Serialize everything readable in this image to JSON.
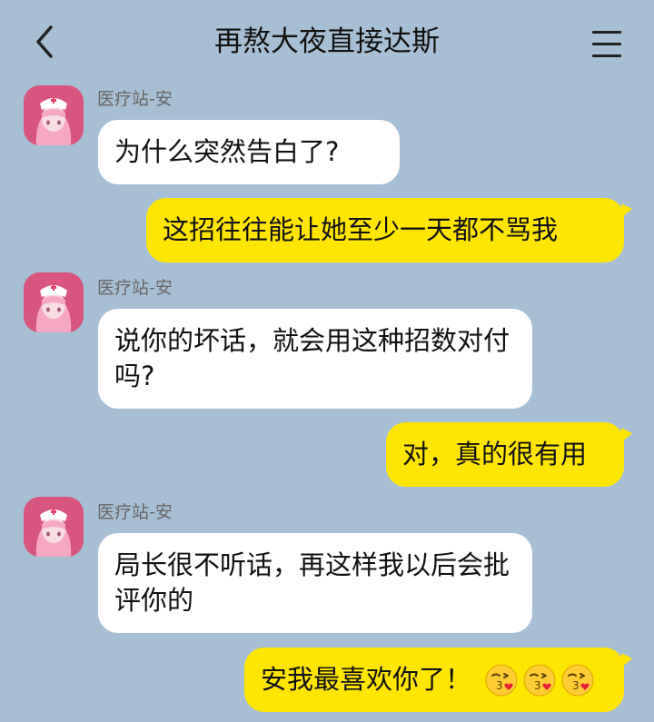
{
  "header": {
    "title": "再熬大夜直接达斯",
    "back_icon": "chevron-left-icon",
    "menu_icon": "hamburger-menu-icon"
  },
  "messages": [
    {
      "direction": "in",
      "sender": "医疗站-安",
      "text": "为什么突然告白了?"
    },
    {
      "direction": "out",
      "text": "这招往往能让她至少一天都不骂我"
    },
    {
      "direction": "in",
      "sender": "医疗站-安",
      "text": "说你的坏话，就会用这种招数对付吗?"
    },
    {
      "direction": "out",
      "text": "对，真的很有用"
    },
    {
      "direction": "in",
      "sender": "医疗站-安",
      "text": "局长很不听话，再这样我以后会批评你的"
    },
    {
      "direction": "out",
      "text": "安我最喜欢你了！",
      "emoji_icons": [
        "kissing-heart-emoji-icon",
        "kissing-heart-emoji-icon",
        "kissing-heart-emoji-icon"
      ]
    }
  ],
  "colors": {
    "background": "#a7bfd4",
    "incoming_bubble": "#ffffff",
    "outgoing_bubble": "#ffe600",
    "avatar": "#d8557f"
  }
}
